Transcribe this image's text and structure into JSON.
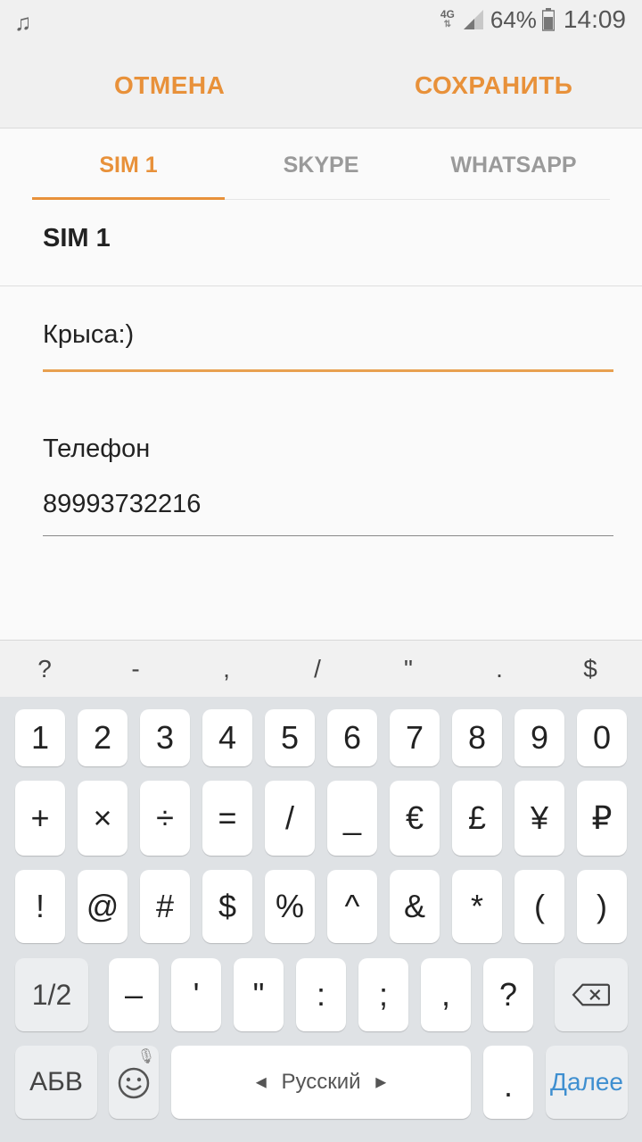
{
  "status_bar": {
    "network": "4G",
    "battery_percent": "64%",
    "time": "14:09"
  },
  "actions": {
    "cancel": "ОТМЕНА",
    "save": "СОХРАНИТЬ"
  },
  "tabs": [
    {
      "label": "SIM 1",
      "selected": true
    },
    {
      "label": "SKYPE",
      "selected": false
    },
    {
      "label": "WHATSAPP",
      "selected": false
    }
  ],
  "section_title": "SIM 1",
  "name_field": {
    "value": "Крыса:)"
  },
  "phone_field": {
    "label": "Телефон",
    "value": "89993732216"
  },
  "keyboard": {
    "suggestions": [
      "?",
      "-",
      ",",
      "/",
      "\"",
      ".",
      "$"
    ],
    "row1": [
      "1",
      "2",
      "3",
      "4",
      "5",
      "6",
      "7",
      "8",
      "9",
      "0"
    ],
    "row2": [
      "+",
      "×",
      "÷",
      "=",
      "/",
      "_",
      "€",
      "£",
      "¥",
      "₽"
    ],
    "row3": [
      "!",
      "@",
      "#",
      "$",
      "%",
      "^",
      "&",
      "*",
      "(",
      ")"
    ],
    "row4": {
      "page": "1/2",
      "keys": [
        "–",
        "'",
        "\"",
        ":",
        ";",
        ",",
        "?"
      ]
    },
    "row5": {
      "lang_switch": "АБВ",
      "space": "Русский",
      "period": ".",
      "enter": "Далее"
    }
  },
  "colors": {
    "accent": "#e8913a",
    "enter_key": "#3f8fd0"
  }
}
